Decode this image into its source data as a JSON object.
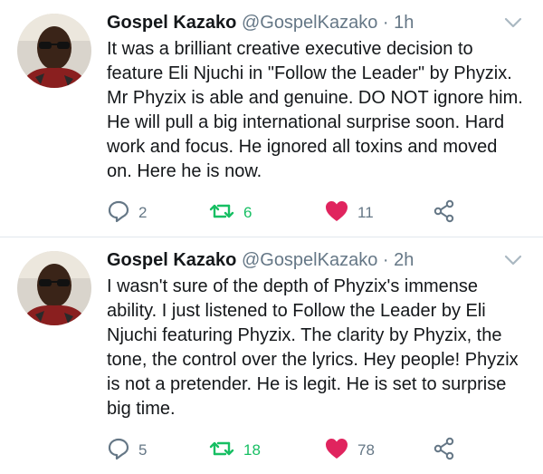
{
  "tweets": [
    {
      "author_name": "Gospel Kazako",
      "handle": "@GospelKazako",
      "separator": "·",
      "time": "1h",
      "text": "It was a brilliant creative executive decision to feature Eli Njuchi in  \"Follow the Leader\" by Phyzix. Mr Phyzix is able and genuine. DO NOT ignore him. He will pull a big international surprise soon. Hard work and focus. He ignored all toxins and moved on. Here he is now.",
      "replies": "2",
      "retweets": "6",
      "likes": "11",
      "liked": true,
      "retweeted": true
    },
    {
      "author_name": "Gospel Kazako",
      "handle": "@GospelKazako",
      "separator": "·",
      "time": "2h",
      "text": "I wasn't sure of the depth of Phyzix's immense ability. I just listened to Follow the Leader by Eli Njuchi featuring Phyzix. The clarity by Phyzix, the tone, the control over the lyrics. Hey people! Phyzix is not a pretender. He is legit. He is set to surprise big time.",
      "replies": "5",
      "retweets": "18",
      "likes": "78",
      "liked": true,
      "retweeted": true
    }
  ],
  "icons": {
    "reply": "reply-icon",
    "retweet": "retweet-icon",
    "like": "heart-icon",
    "share": "share-icon",
    "menu": "chevron-down-icon"
  },
  "colors": {
    "like": "#e0245e",
    "retweet": "#17bf63",
    "secondary_text": "#657786",
    "divider": "#e1e8ed"
  }
}
